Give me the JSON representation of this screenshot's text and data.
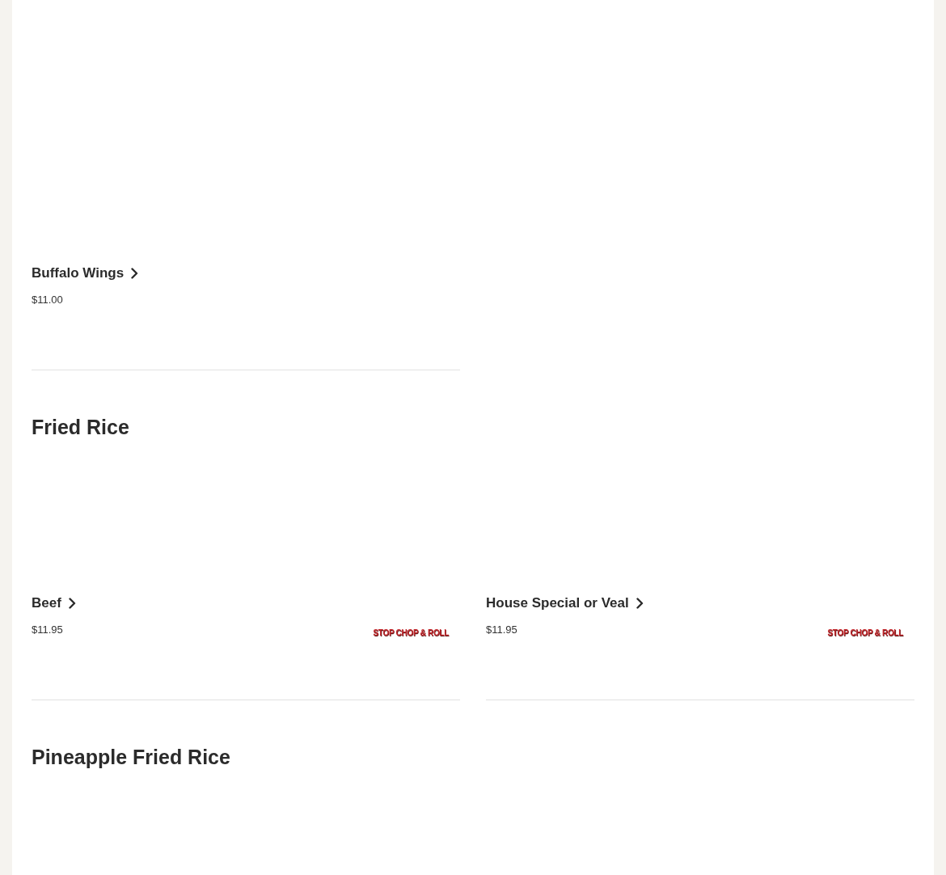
{
  "sections": [
    {
      "items": [
        {
          "name": "Buffalo Wings",
          "price": "$11.00"
        }
      ]
    },
    {
      "title": "Fried Rice",
      "items": [
        {
          "name": "Beef",
          "price": "$11.95",
          "logo": "STOP CHOP & ROLL"
        },
        {
          "name": "House Special or Veal",
          "price": "$11.95",
          "logo": "STOP CHOP & ROLL"
        }
      ]
    },
    {
      "title": "Pineapple Fried Rice"
    }
  ]
}
